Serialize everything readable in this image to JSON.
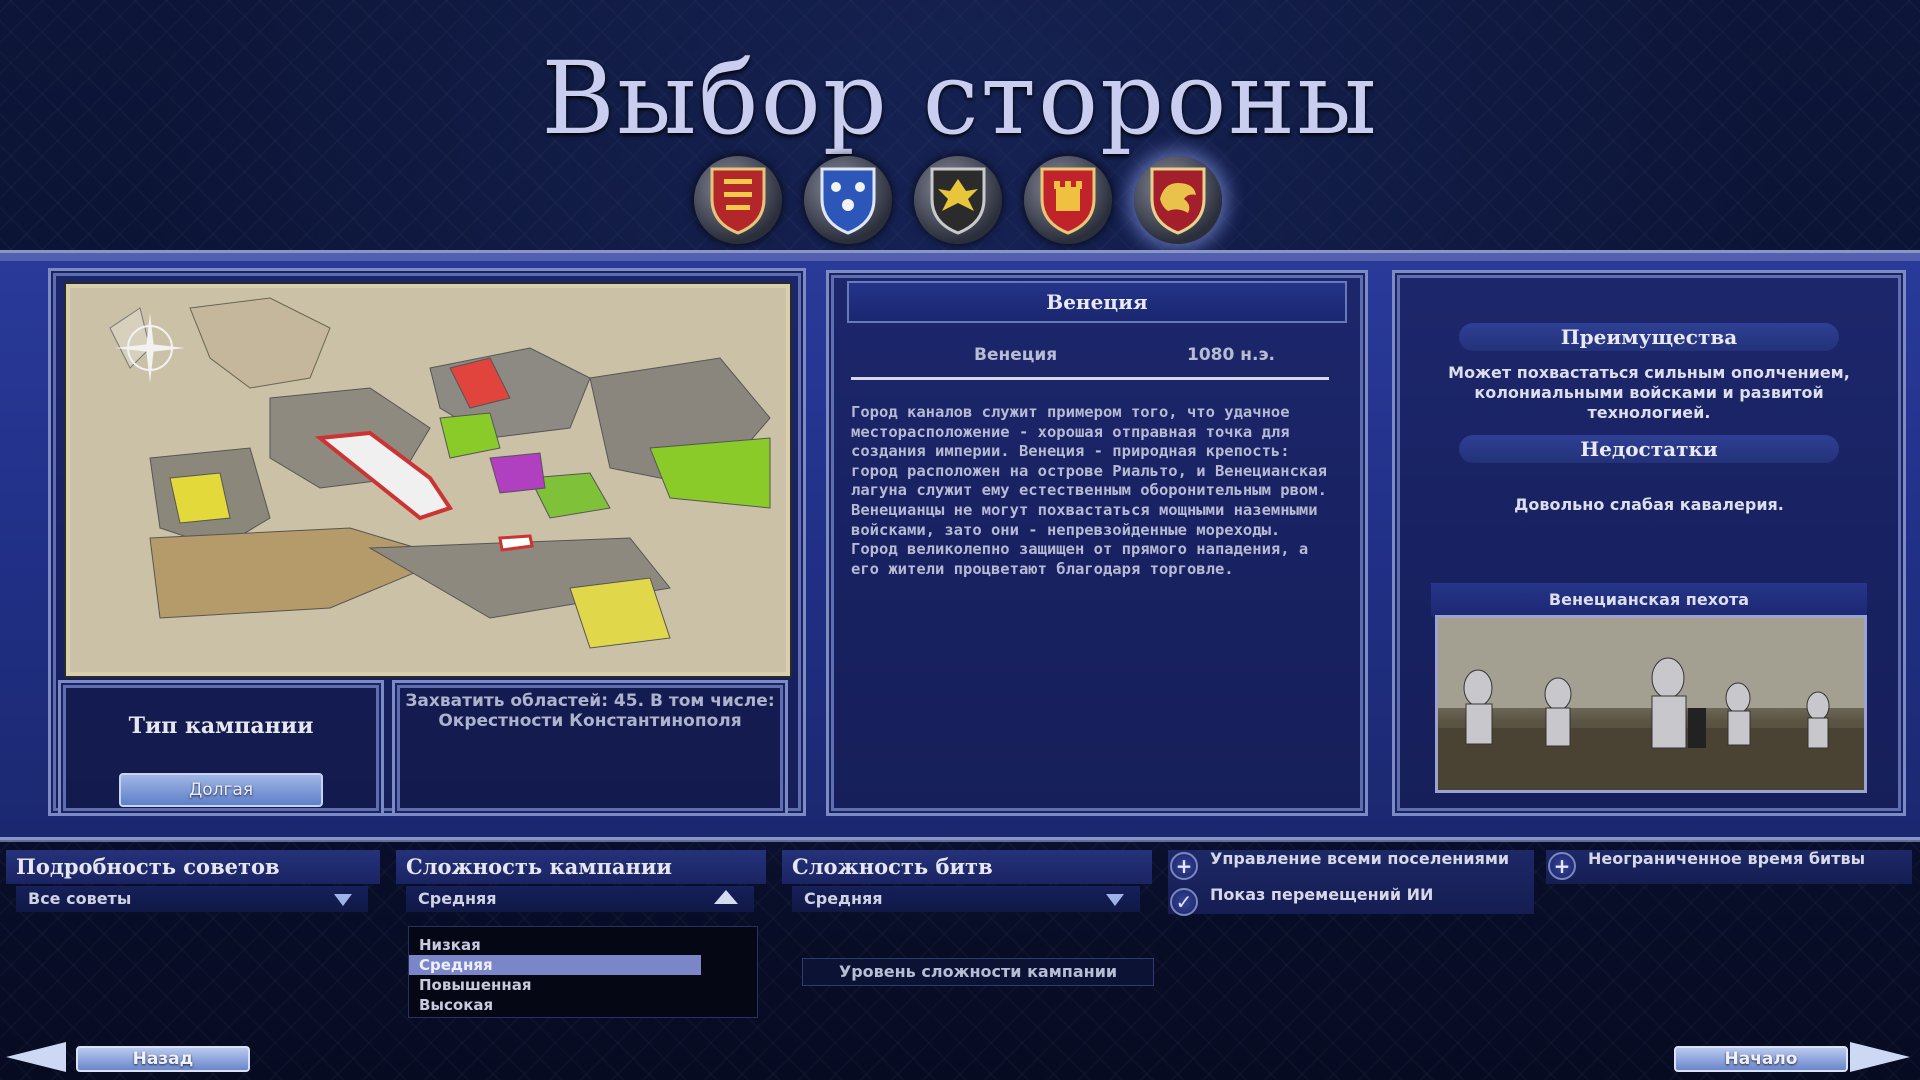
{
  "title": "Выбор стороны",
  "factions": [
    {
      "icon": "england-lions-shield-icon",
      "color": "#b3262a"
    },
    {
      "icon": "france-fleur-shield-icon",
      "color": "#2c56b8"
    },
    {
      "icon": "hre-eagle-shield-icon",
      "color": "#2b2b2b"
    },
    {
      "icon": "spain-castle-shield-icon",
      "color": "#c0242a"
    },
    {
      "icon": "venice-lion-shield-icon",
      "color": "#a31f2b",
      "selected": true
    }
  ],
  "faction": {
    "name": "Венеция",
    "region": "Венеция",
    "year": "1080 н.э.",
    "description": "Город каналов служит примером того, что удачное месторасположение - хорошая отправная точка для создания империи. Венеция - природная крепость: город расположен на острове Риальто, и Венецианская лагуна служит ему естественным оборонительным рвом. Венецианцы не могут похвастаться мощными наземными войсками, зато они - непревзойденные мореходы. Город великолепно защищен от прямого нападения, а его жители процветают благодаря торговле.",
    "advantages_title": "Преимущества",
    "advantages": "Может похвастаться сильным ополчением, колониальными войсками и развитой технологией.",
    "disadvantages_title": "Недостатки",
    "disadvantages": "Довольно слабая кавалерия.",
    "unit_name": "Венецианская пехота"
  },
  "campaign": {
    "type_label": "Тип кампании",
    "type_value": "Долгая",
    "goal": "Захватить областей: 45. В том числе: Окрестности Константинополя"
  },
  "options": {
    "advice": {
      "label": "Подробность советов",
      "value": "Все советы"
    },
    "campaign_difficulty": {
      "label": "Сложность кампании",
      "value": "Средняя",
      "options": [
        "Низкая",
        "Средняя",
        "Повышенная",
        "Высокая"
      ],
      "selected_index": 1,
      "tooltip": "Уровень сложности кампании"
    },
    "battle_difficulty": {
      "label": "Сложность битв",
      "value": "Средняя"
    },
    "manage_all": "Управление всеми поселениями",
    "show_ai_moves": "Показ перемещений ИИ",
    "unlimited_time": "Неограниченное время битвы"
  },
  "nav": {
    "back": "Назад",
    "start": "Начало"
  }
}
